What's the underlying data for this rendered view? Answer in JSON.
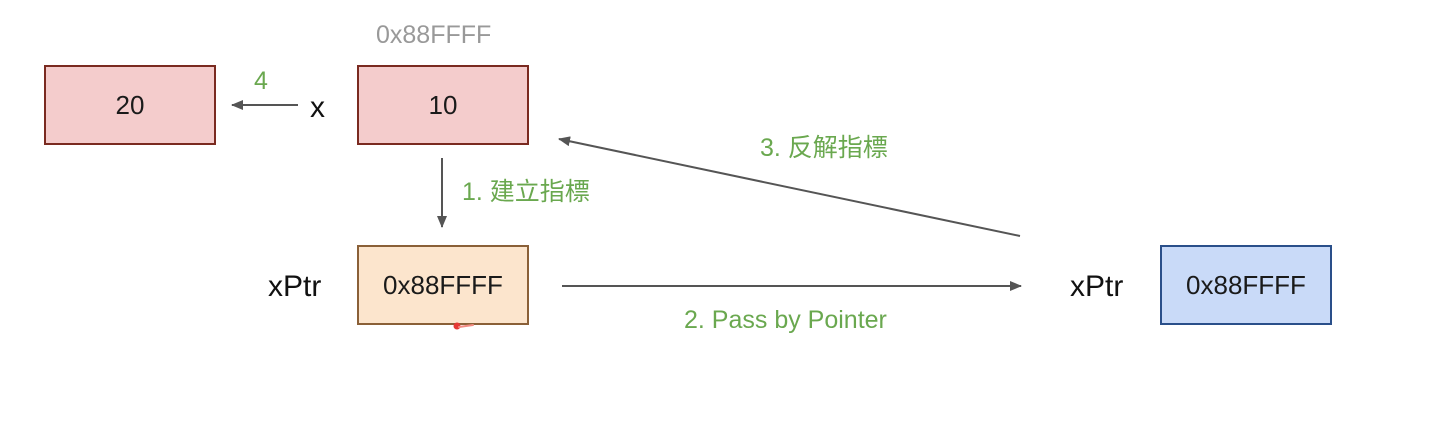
{
  "boxes": {
    "old_value": "20",
    "x_value": "10",
    "xptr_local_value": "0x88FFFF",
    "xptr_param_value": "0x88FFFF"
  },
  "labels": {
    "x": "x",
    "xptr_local": "xPtr",
    "xptr_param": "xPtr",
    "x_address": "0x88FFFF"
  },
  "steps": {
    "step1": "1. 建立指標",
    "step2": "2. Pass by Pointer",
    "step3": "3. 反解指標",
    "step4": "4"
  },
  "colors": {
    "value_box_fill": "#f4cccc",
    "value_box_border": "#7a2a20",
    "local_ptr_fill": "#fce5cd",
    "local_ptr_border": "#8a6038",
    "param_ptr_fill": "#c9daf8",
    "param_ptr_border": "#2a4f8a",
    "step_text": "#6aa84f",
    "address_text": "#999999",
    "arrow": "#555555"
  }
}
